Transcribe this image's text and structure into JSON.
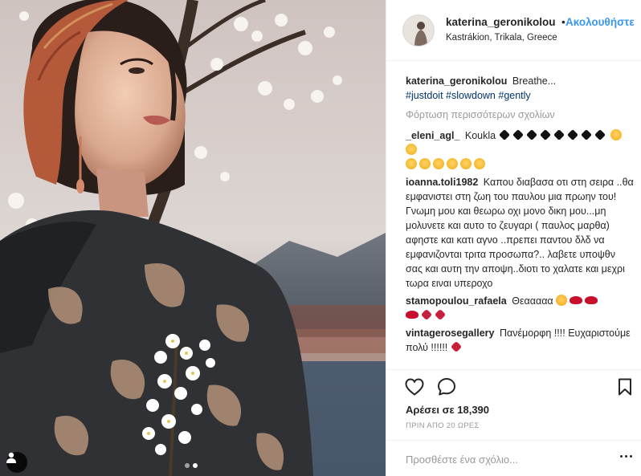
{
  "post": {
    "username": "katerina_geronikolou",
    "follow_label": "Ακολουθήστε",
    "separator": "•",
    "location": "Kastrákion, Trikala, Greece",
    "caption_user": "katerina_geronikolou",
    "caption_text": "Breathe...",
    "hashtags": [
      "#justdoit",
      "#slowdown",
      "#gently"
    ],
    "load_more": "Φόρτωση περισσότερων σχολίων",
    "likes": "Αρέσει σε 18,390",
    "time_ago": "ΠΡΙΝ ΑΠΟ 20 ΩΡΕΣ",
    "add_comment_placeholder": "Προσθέστε ένα σχόλιο..."
  },
  "comments": [
    {
      "user": "_eleni_agl_",
      "text": "Koukla"
    },
    {
      "user": "ioanna.toli1982",
      "text": "Καπου διαβασα οτι στη σειρα ..θα εμφανιστει στη ζωη του παυλου μια πρωην του! Γνωμη μου και θεωρω οχι μονο δικη μου...μη μολυνετε και αυτο το ζευγαρι ( παυλος μαρθα) αφηστε και κατι αγνο ..πρεπει παντου δλδ να εμφανιζονται τριτα προσωπα?.. λαβετε υποψθν σας και αυτη την αποψη..διοτι το χαλατε και μεχρι τωρα ειναι υπεροχο"
    },
    {
      "user": "stamopoulou_rafaela",
      "text": "Θεααααα"
    },
    {
      "user": "vintagerosegallery",
      "text": "Πανέμορφη !!!! Ευχαριστούμε πολύ !!!!!!"
    }
  ],
  "icons": {
    "like": "heart-outline-icon",
    "comment": "speech-bubble-icon",
    "save": "bookmark-icon",
    "user_tag": "user-silhouette-icon",
    "more": "ellipsis-icon"
  },
  "carousel": {
    "count": 2,
    "active": 2
  },
  "colors": {
    "link": "#3897f0",
    "hashtag": "#003569",
    "muted": "#999999",
    "text": "#262626"
  }
}
